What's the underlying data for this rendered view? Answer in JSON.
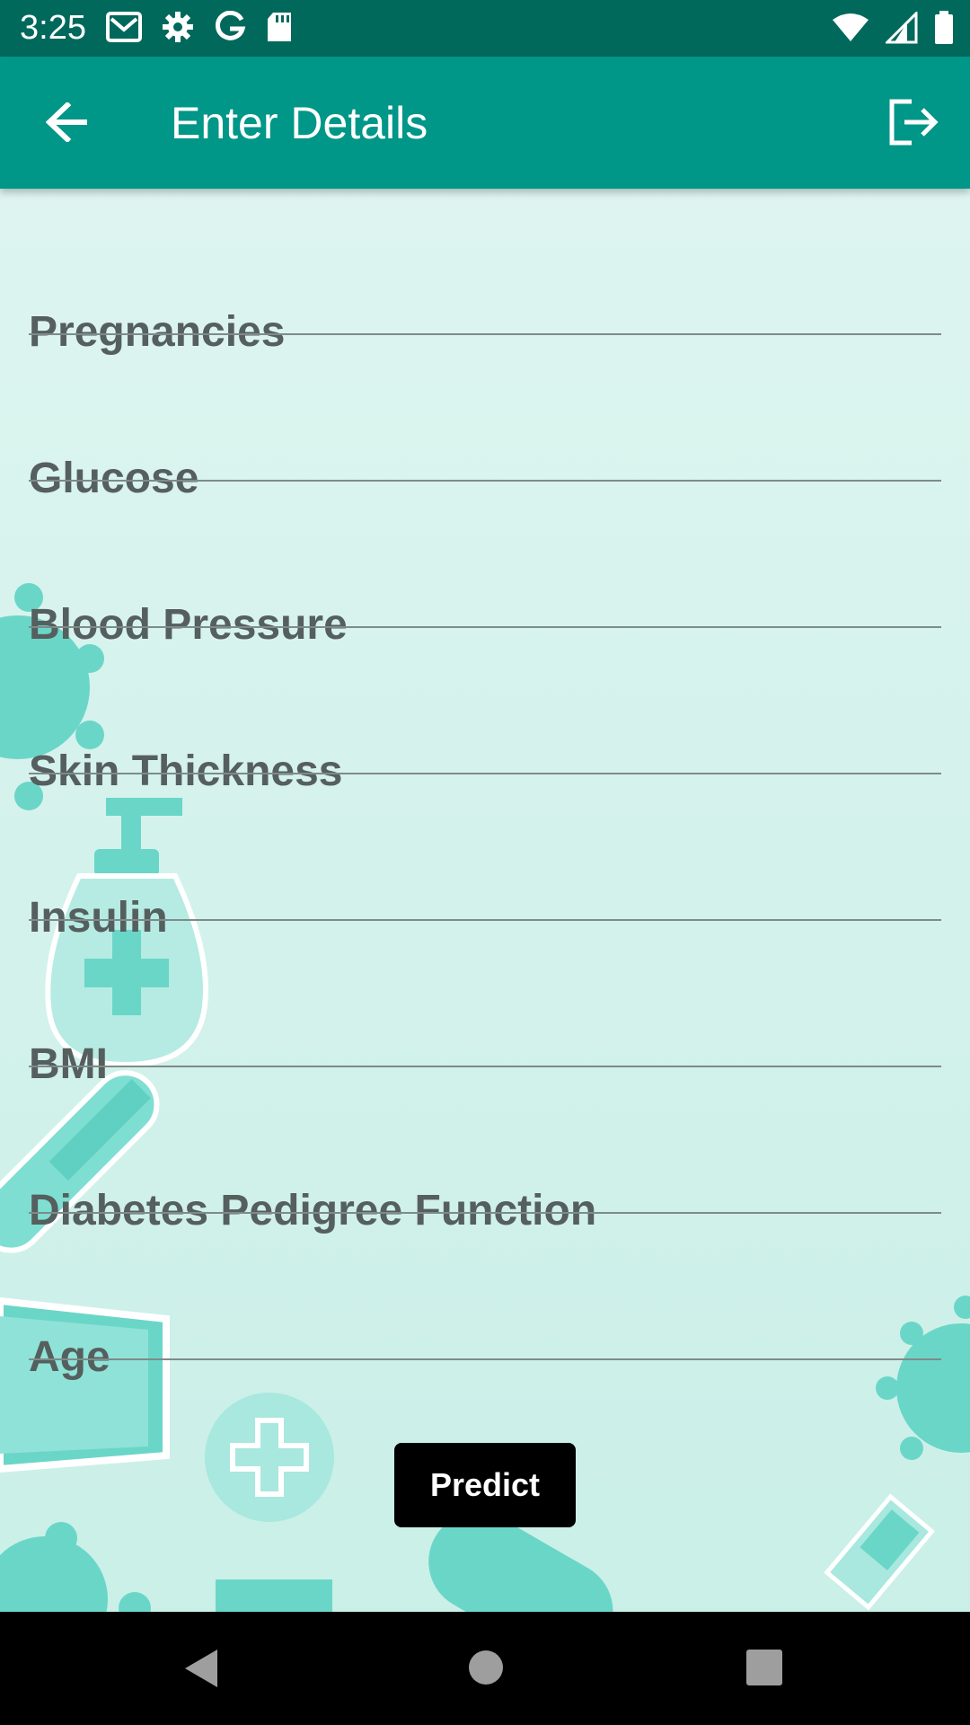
{
  "status_bar": {
    "time": "3:25",
    "left_icons": [
      "gmail-icon",
      "settings-icon",
      "google-icon",
      "sd-card-icon"
    ],
    "right_icons": [
      "wifi-icon",
      "cell-signal-icon",
      "battery-icon"
    ]
  },
  "app_bar": {
    "title": "Enter Details",
    "back_icon": "arrow-back-icon",
    "logout_icon": "logout-icon",
    "color": "#009688",
    "status_color": "#00695c"
  },
  "form": {
    "fields": [
      {
        "label": "Pregnancies",
        "value": ""
      },
      {
        "label": "Glucose",
        "value": ""
      },
      {
        "label": "Blood Pressure",
        "value": ""
      },
      {
        "label": "Skin Thickness",
        "value": ""
      },
      {
        "label": "Insulin",
        "value": ""
      },
      {
        "label": "BMI",
        "value": ""
      },
      {
        "label": "Diabetes Pedigree Function",
        "value": ""
      },
      {
        "label": "Age",
        "value": ""
      }
    ]
  },
  "predict_button": {
    "label": "Predict"
  },
  "nav_bar": {
    "icons": [
      "nav-back-icon",
      "nav-home-icon",
      "nav-recents-icon"
    ]
  },
  "colors": {
    "background": "#dff4f0",
    "decoration": "#6fd9cc",
    "hint_text": "#555f5e",
    "underline": "#7f8b89"
  }
}
